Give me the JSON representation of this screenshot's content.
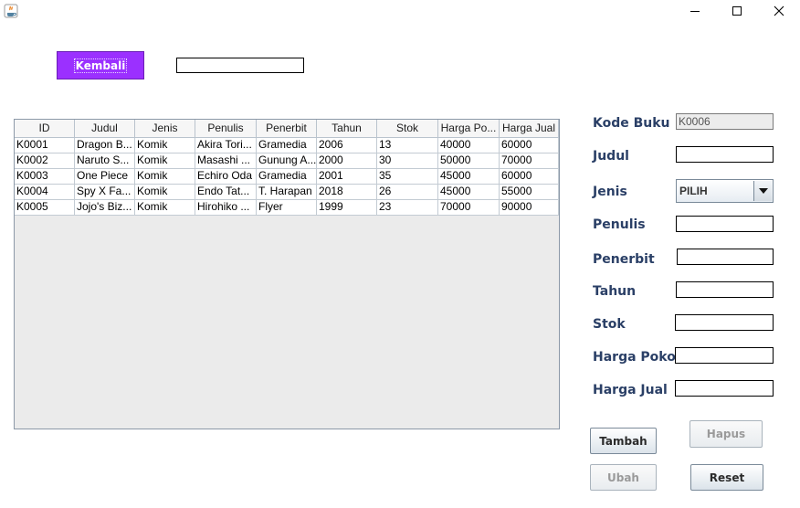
{
  "window": {
    "minimize_glyph": "minimize-icon",
    "maximize_glyph": "maximize-icon",
    "close_glyph": "close-icon"
  },
  "header": {
    "back_label": "Kembali",
    "search_value": ""
  },
  "table": {
    "columns": [
      "ID",
      "Judul",
      "Jenis",
      "Penulis",
      "Penerbit",
      "Tahun",
      "Stok",
      "Harga Po...",
      "Harga Jual"
    ],
    "rows": [
      [
        "K0001",
        "Dragon B...",
        "Komik",
        "Akira Tori...",
        "Gramedia",
        "2006",
        "13",
        "40000",
        "60000"
      ],
      [
        "K0002",
        "Naruto S...",
        "Komik",
        "Masashi ...",
        "Gunung A...",
        "2000",
        "30",
        "50000",
        "70000"
      ],
      [
        "K0003",
        "One Piece",
        "Komik",
        "Echiro Oda",
        "Gramedia",
        "2001",
        "35",
        "45000",
        "60000"
      ],
      [
        "K0004",
        "Spy X Fa...",
        "Komik",
        "Endo Tat...",
        "T. Harapan",
        "2018",
        "26",
        "45000",
        "55000"
      ],
      [
        "K0005",
        "Jojo's Biz...",
        "Komik",
        "Hirohiko ...",
        "Flyer",
        "1999",
        "23",
        "70000",
        "90000"
      ]
    ]
  },
  "form": {
    "kode_buku_label": "Kode Buku",
    "kode_buku_value": "K0006",
    "judul_label": "Judul",
    "jenis_label": "Jenis",
    "jenis_value": "PILIH",
    "penulis_label": "Penulis",
    "penerbit_label": "Penerbit",
    "tahun_label": "Tahun",
    "stok_label": "Stok",
    "harga_pokok_label": "Harga Pokok",
    "harga_jual_label": "Harga Jual"
  },
  "buttons": {
    "tambah": "Tambah",
    "hapus": "Hapus",
    "ubah": "Ubah",
    "reset": "Reset"
  },
  "colors": {
    "back_button": "#9b30ff",
    "label_text": "#2a3f66"
  }
}
